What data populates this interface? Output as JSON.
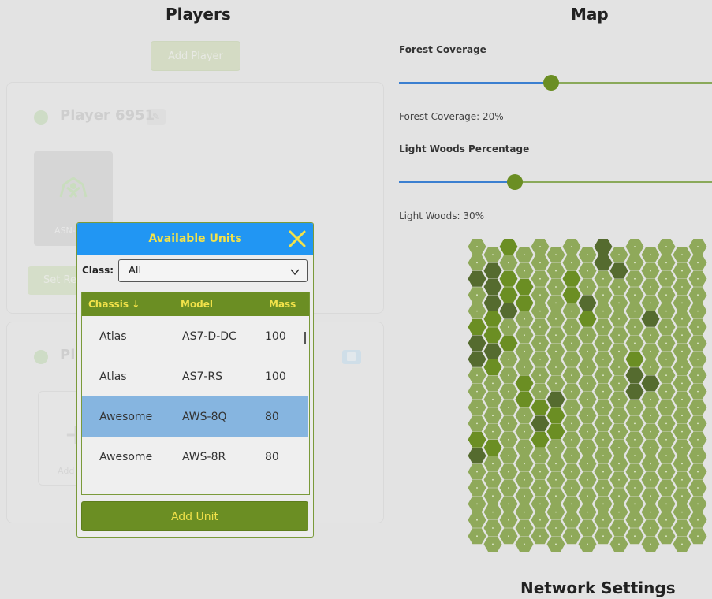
{
  "players": {
    "title": "Players",
    "add_player_label": "Add Player",
    "player1": {
      "name": "Player 6951",
      "unit_label": "ASN-",
      "set_label": "Set Re"
    },
    "player2": {
      "name": "Pla",
      "add_tile_label": "Add"
    }
  },
  "map": {
    "title": "Map",
    "forest": {
      "label": "Forest Coverage",
      "value_text": "Forest Coverage: 20%",
      "value": 0.2
    },
    "light_woods": {
      "label": "Light Woods Percentage",
      "value_text": "Light Woods: 30%",
      "value": 0.3
    },
    "colors": {
      "clear": "#8fa95a",
      "light_woods": "#6b8e23",
      "heavy_woods": "#556b2f"
    }
  },
  "network": {
    "title": "Network Settings"
  },
  "modal": {
    "title": "Available Units",
    "class_label": "Class:",
    "class_value": "All",
    "columns": {
      "chassis": "Chassis ↓",
      "model": "Model",
      "mass": "Mass"
    },
    "rows": [
      {
        "chassis": "Atlas",
        "model": "AS7-D-DC",
        "mass": "100"
      },
      {
        "chassis": "Atlas",
        "model": "AS7-RS",
        "mass": "100"
      },
      {
        "chassis": "Awesome",
        "model": "AWS-8Q",
        "mass": "80"
      },
      {
        "chassis": "Awesome",
        "model": "AWS-8R",
        "mass": "80"
      }
    ],
    "add_unit_label": "Add Unit"
  },
  "colors": {
    "accent_blue": "#2196f3",
    "olive": "#6b8e23",
    "gold": "#f2e24a",
    "selected_row": "#86b5e0"
  }
}
